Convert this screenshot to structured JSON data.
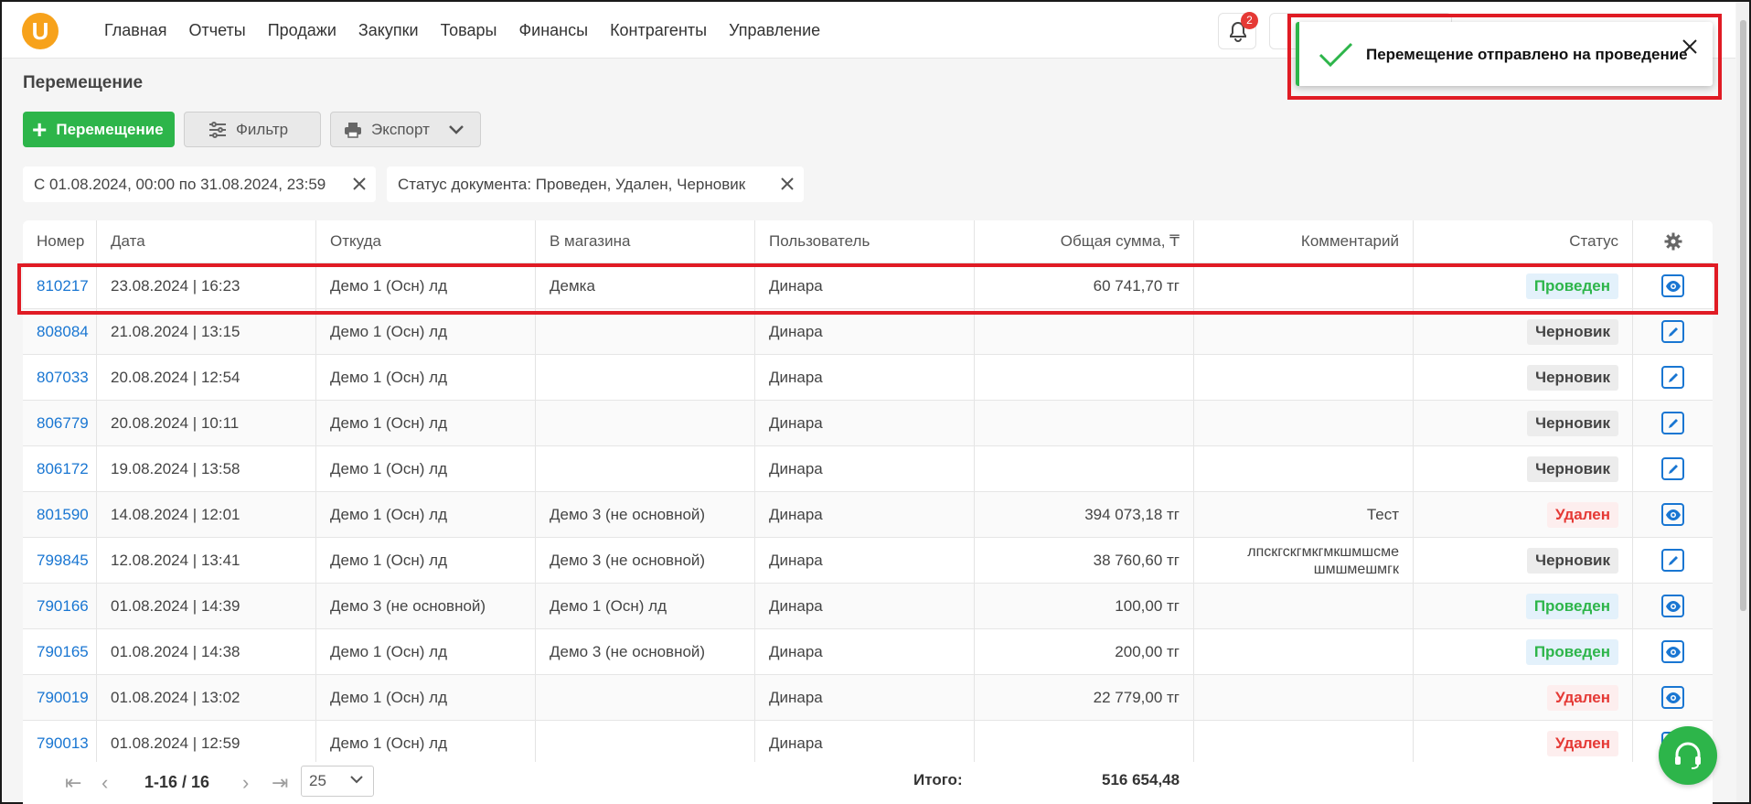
{
  "nav": {
    "logo": "U",
    "items": [
      "Главная",
      "Отчеты",
      "Продажи",
      "Закупки",
      "Товары",
      "Финансы",
      "Контрагенты",
      "Управление"
    ],
    "notifications_count": "2"
  },
  "page": {
    "title": "Перемещение"
  },
  "toolbar": {
    "add_label": "Перемещение",
    "filter_label": "Фильтр",
    "export_label": "Экспорт"
  },
  "filters": {
    "date_range": "С 01.08.2024, 00:00 по 31.08.2024, 23:59",
    "status": "Статус документа: Проведен, Удален, Черновик"
  },
  "table": {
    "headers": {
      "number": "Номер",
      "date": "Дата",
      "from": "Откуда",
      "to": "В магазина",
      "user": "Пользователь",
      "sum": "Общая сумма, ₸",
      "comment": "Комментарий",
      "status": "Статус"
    },
    "rows": [
      {
        "number": "810217",
        "date": "23.08.2024 | 16:23",
        "from": "Демо 1 (Осн) лд",
        "to": "Демка",
        "user": "Динара",
        "sum": "60 741,70 тг",
        "comment": "",
        "status": "Проведен",
        "status_type": "ok",
        "action": "view"
      },
      {
        "number": "808084",
        "date": "21.08.2024 | 13:15",
        "from": "Демо 1 (Осн) лд",
        "to": "",
        "user": "Динара",
        "sum": "",
        "comment": "",
        "status": "Черновик",
        "status_type": "draft",
        "action": "edit"
      },
      {
        "number": "807033",
        "date": "20.08.2024 | 12:54",
        "from": "Демо 1 (Осн) лд",
        "to": "",
        "user": "Динара",
        "sum": "",
        "comment": "",
        "status": "Черновик",
        "status_type": "draft",
        "action": "edit"
      },
      {
        "number": "806779",
        "date": "20.08.2024 | 10:11",
        "from": "Демо 1 (Осн) лд",
        "to": "",
        "user": "Динара",
        "sum": "",
        "comment": "",
        "status": "Черновик",
        "status_type": "draft",
        "action": "edit"
      },
      {
        "number": "806172",
        "date": "19.08.2024 | 13:58",
        "from": "Демо 1 (Осн) лд",
        "to": "",
        "user": "Динара",
        "sum": "",
        "comment": "",
        "status": "Черновик",
        "status_type": "draft",
        "action": "edit"
      },
      {
        "number": "801590",
        "date": "14.08.2024 | 12:01",
        "from": "Демо 1 (Осн) лд",
        "to": "Демо 3 (не основной)",
        "user": "Динара",
        "sum": "394 073,18 тг",
        "comment": "Тест",
        "status": "Удален",
        "status_type": "del",
        "action": "view"
      },
      {
        "number": "799845",
        "date": "12.08.2024 | 13:41",
        "from": "Демо 1 (Осн) лд",
        "to": "Демо 3 (не основной)",
        "user": "Динара",
        "sum": "38 760,60 тг",
        "comment": "лпскгскгмкгмкшмшсме шмшмешмгк",
        "status": "Черновик",
        "status_type": "draft",
        "action": "edit"
      },
      {
        "number": "790166",
        "date": "01.08.2024 | 14:39",
        "from": "Демо 3 (не основной)",
        "to": "Демо 1 (Осн) лд",
        "user": "Динара",
        "sum": "100,00 тг",
        "comment": "",
        "status": "Проведен",
        "status_type": "ok",
        "action": "view"
      },
      {
        "number": "790165",
        "date": "01.08.2024 | 14:38",
        "from": "Демо 1 (Осн) лд",
        "to": "Демо 3 (не основной)",
        "user": "Динара",
        "sum": "200,00 тг",
        "comment": "",
        "status": "Проведен",
        "status_type": "ok",
        "action": "view"
      },
      {
        "number": "790019",
        "date": "01.08.2024 | 13:02",
        "from": "Демо 1 (Осн) лд",
        "to": "",
        "user": "Динара",
        "sum": "22 779,00 тг",
        "comment": "",
        "status": "Удален",
        "status_type": "del",
        "action": "view"
      },
      {
        "number": "790013",
        "date": "01.08.2024 | 12:59",
        "from": "Демо 1 (Осн) лд",
        "to": "",
        "user": "Динара",
        "sum": "",
        "comment": "",
        "status": "Удален",
        "status_type": "del",
        "action": "view"
      }
    ]
  },
  "footer": {
    "range": "1-16 / 16",
    "page_size": "25",
    "total_label": "Итого:",
    "total_value": "516 654,48"
  },
  "toast": {
    "message": "Перемещение отправлено на проведение"
  },
  "colors": {
    "accent": "#2db54a",
    "link": "#1976d2",
    "danger": "#e53935",
    "highlight": "#e01b24",
    "logo": "#f7a21b"
  }
}
